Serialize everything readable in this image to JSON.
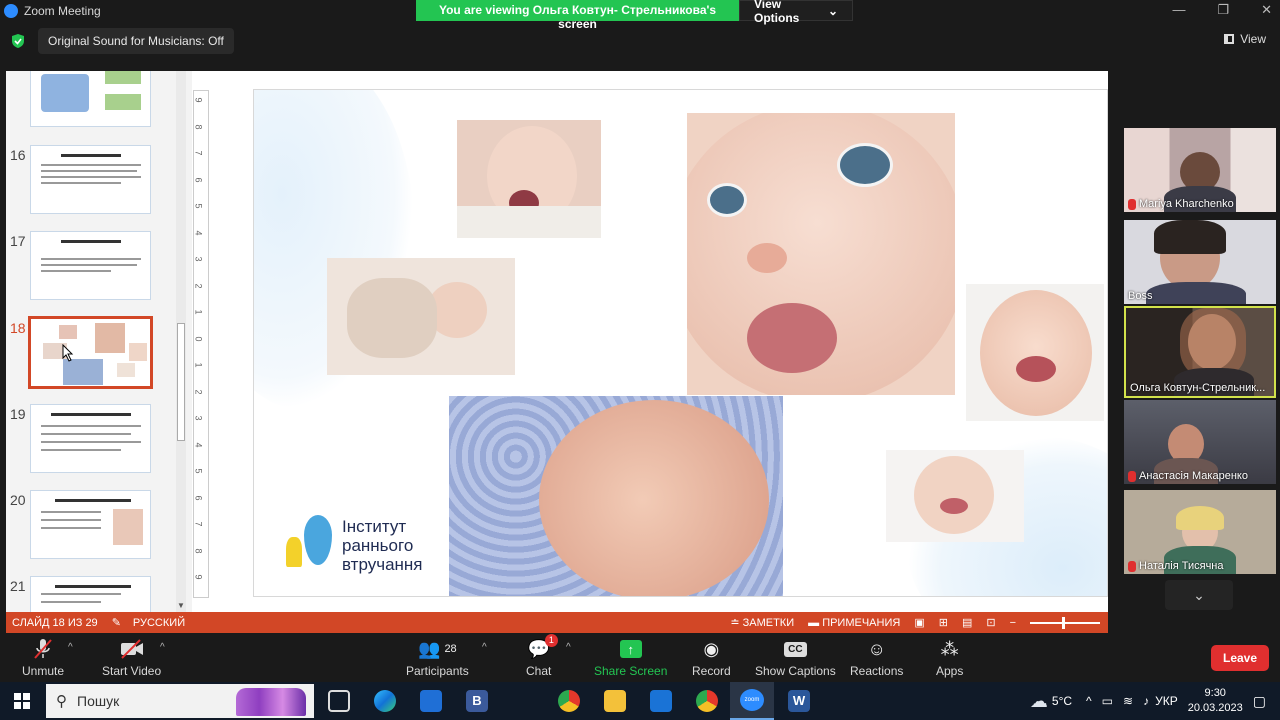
{
  "titlebar": {
    "app_title": "Zoom Meeting",
    "viewing_banner": "You are viewing Ольга Ковтун- Стрельникова's screen",
    "view_options": "View Options"
  },
  "infobar": {
    "original_sound": "Original Sound for Musicians: Off",
    "view": "View"
  },
  "slides": {
    "thumbnails": [
      {
        "num": "",
        "active": false
      },
      {
        "num": "16",
        "active": false
      },
      {
        "num": "17",
        "active": false
      },
      {
        "num": "18",
        "active": true
      },
      {
        "num": "19",
        "active": false
      },
      {
        "num": "20",
        "active": false
      },
      {
        "num": "21",
        "active": false
      }
    ],
    "ruler": [
      "9",
      "8",
      "7",
      "6",
      "5",
      "4",
      "3",
      "2",
      "1",
      "0",
      "1",
      "2",
      "3",
      "4",
      "5",
      "6",
      "7",
      "8",
      "9"
    ]
  },
  "slide_logo": {
    "line1": "Інститут",
    "line2": "раннього",
    "line3": "втручання"
  },
  "statusbar": {
    "slide_counter": "СЛАЙД 18 ИЗ 29",
    "language": "РУССКИЙ",
    "notes": "ЗАМЕТКИ",
    "comments": "ПРИМЕЧАНИЯ"
  },
  "participants": [
    {
      "name": "Mariya Kharchenko",
      "muted": true
    },
    {
      "name": "Boss",
      "muted": false
    },
    {
      "name": "Ольга Ковтун-Стрельник...",
      "muted": false,
      "active": true
    },
    {
      "name": "Анастасія Макаренко",
      "muted": true
    },
    {
      "name": "Наталія Тисячна",
      "muted": true
    }
  ],
  "toolbar": {
    "unmute": "Unmute",
    "start_video": "Start Video",
    "participants": "Participants",
    "participants_count": "28",
    "chat": "Chat",
    "chat_badge": "1",
    "share_screen": "Share Screen",
    "record": "Record",
    "show_captions": "Show Captions",
    "reactions": "Reactions",
    "apps": "Apps",
    "leave": "Leave"
  },
  "taskbar": {
    "search_text": "Пошук",
    "temperature": "5°C",
    "language": "УКР",
    "time": "9:30",
    "date": "20.03.2023"
  },
  "colors": {
    "zoom_blue": "#2d8cff",
    "banner_green": "#23c552",
    "ppt_orange": "#d24726",
    "leave_red": "#e02f2f"
  }
}
